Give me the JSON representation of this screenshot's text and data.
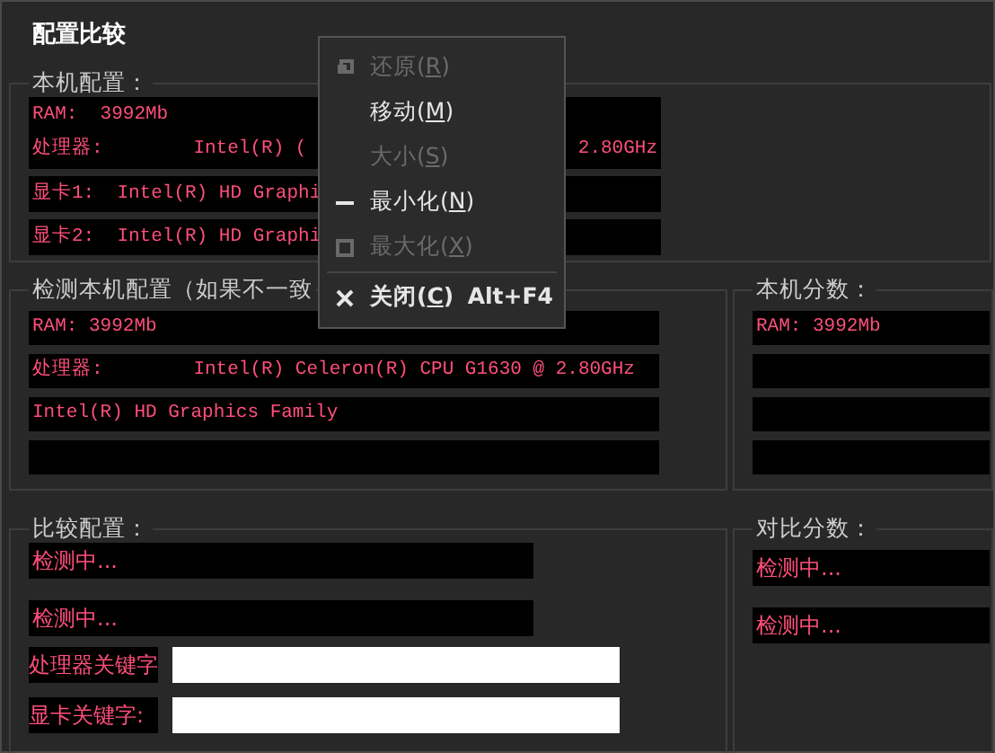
{
  "window": {
    "title": "配置比较"
  },
  "local_config": {
    "label": "本机配置：",
    "boxes": [
      {
        "lines": [
          {
            "text": "RAM:  3992Mb"
          },
          {
            "text": "处理器:        Intel(R) (",
            "right_text": "2.80GHz"
          }
        ]
      },
      {
        "lines": [
          {
            "text": "显卡1:  Intel(R) HD Graphi"
          }
        ]
      },
      {
        "lines": [
          {
            "text": "显卡2:  Intel(R) HD Graphi"
          }
        ]
      }
    ]
  },
  "detected_config": {
    "label": "检测本机配置（如果不一致",
    "boxes": [
      {
        "lines": [
          {
            "text": "RAM: 3992Mb"
          }
        ]
      },
      {
        "lines": [
          {
            "text": "处理器:        Intel(R) Celeron(R) CPU G1630 @ 2.80GHz"
          }
        ]
      },
      {
        "lines": [
          {
            "text": "Intel(R) HD Graphics Family"
          }
        ]
      },
      {
        "kind": "blank"
      }
    ]
  },
  "local_score": {
    "label": "本机分数：",
    "boxes": [
      {
        "lines": [
          {
            "text": "RAM: 3992Mb"
          }
        ]
      },
      {
        "kind": "blank"
      },
      {
        "kind": "blank"
      },
      {
        "kind": "blank"
      }
    ]
  },
  "compare_config": {
    "label": "比较配置：",
    "boxes": [
      {
        "lines": [
          {
            "text": "检测中..."
          }
        ]
      },
      {
        "lines": [
          {
            "text": "检测中..."
          }
        ]
      }
    ],
    "fields": [
      {
        "label": "处理器关键字"
      },
      {
        "label": "显卡关键字:"
      }
    ]
  },
  "compare_score": {
    "label": "对比分数：",
    "boxes": [
      {
        "lines": [
          {
            "text": "检测中..."
          }
        ]
      },
      {
        "lines": [
          {
            "text": "检测中..."
          }
        ]
      }
    ]
  },
  "context_menu": {
    "items": [
      {
        "kind": "restore",
        "label": "还原(R)",
        "disabled": true
      },
      {
        "kind": "none",
        "label": "移动(M)",
        "disabled": false
      },
      {
        "kind": "none",
        "label": "大小(S)",
        "disabled": true
      },
      {
        "kind": "minimize",
        "label": "最小化(N)",
        "disabled": false
      },
      {
        "kind": "maximize",
        "label": "最大化(X)",
        "disabled": true
      },
      {
        "kind": "close",
        "label": "关闭(C)",
        "shortcut": "Alt+F4",
        "disabled": false,
        "separator_before": true
      }
    ]
  }
}
